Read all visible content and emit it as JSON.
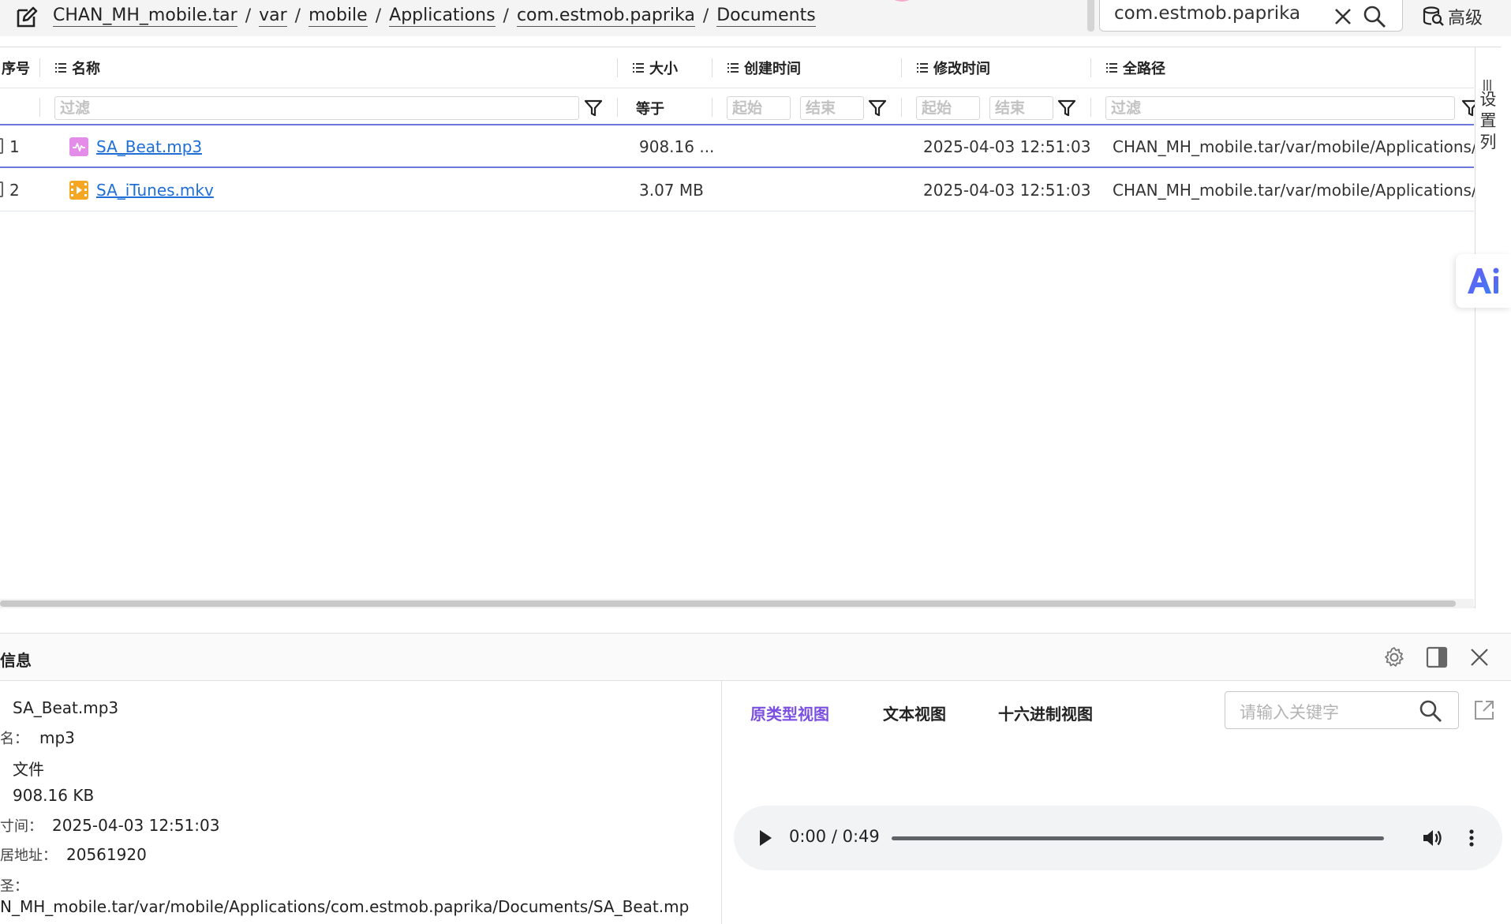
{
  "topbar": {
    "breadcrumb": [
      "CHAN_MH_mobile.tar",
      "var",
      "mobile",
      "Applications",
      "com.estmob.paprika",
      "Documents"
    ],
    "search_value": "com.estmob.paprika",
    "advanced_label": "高级"
  },
  "table": {
    "columns": {
      "index": "序号",
      "name": "名称",
      "size": "大小",
      "created": "创建时间",
      "modified": "修改时间",
      "path": "全路径"
    },
    "filters": {
      "name_placeholder": "过滤",
      "size_label": "等于",
      "created_start": "起始",
      "created_end": "结束",
      "modified_start": "起始",
      "modified_end": "结束",
      "path_placeholder": "过滤"
    },
    "rows": [
      {
        "index": "1",
        "name": "SA_Beat.mp3",
        "size": "908.16 ...",
        "created": "",
        "modified": "2025-04-03 12:51:03",
        "path": "CHAN_MH_mobile.tar/var/mobile/Applications/c..."
      },
      {
        "index": "2",
        "name": "SA_iTunes.mkv",
        "size": "3.07 MB",
        "created": "",
        "modified": "2025-04-03 12:51:03",
        "path": "CHAN_MH_mobile.tar/var/mobile/Applications/c..."
      }
    ],
    "side_settings_label": "设置列",
    "ai_label": "Ai"
  },
  "panel": {
    "title": "信息",
    "props": {
      "name_value": "SA_Beat.mp3",
      "ext_key": "名：",
      "ext_value": "mp3",
      "type_value": "文件",
      "size_value": "908.16 KB",
      "time_key": "寸间：",
      "time_value": "2025-04-03 12:51:03",
      "addr_key": "居地址：",
      "addr_value": "20561920",
      "path_key": "圣：",
      "path_value": "N_MH_mobile.tar/var/mobile/Applications/com.estmob.paprika/Documents/SA_Beat.mp"
    },
    "viewer": {
      "tabs": [
        "原类型视图",
        "文本视图",
        "十六进制视图"
      ],
      "active_tab": 0,
      "keyword_placeholder": "请输入关键字",
      "audio_time": "0:00 / 0:49",
      "audio_progress": 0
    }
  },
  "colors": {
    "accent": "#7b4fe0",
    "link": "#1f6fd6",
    "selection_line": "#6d77d9",
    "mp3_icon": "#e38ce8",
    "mkv_icon": "#f5a623",
    "ai_brand": "#4f6ef7"
  }
}
